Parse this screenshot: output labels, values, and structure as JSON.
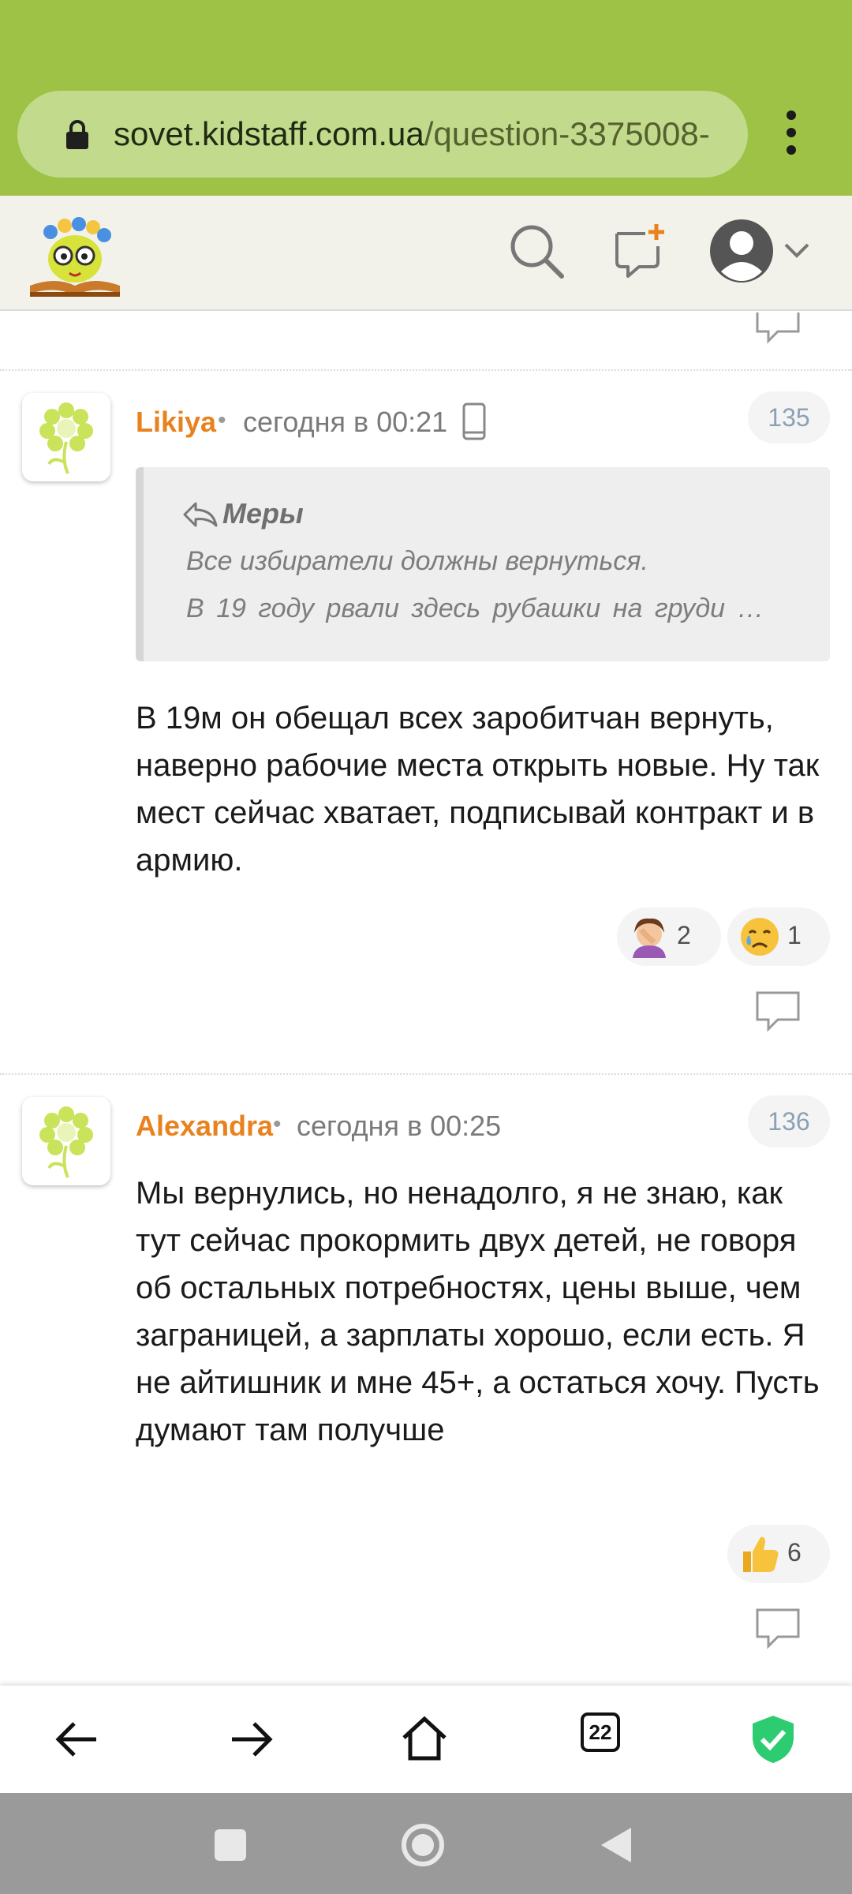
{
  "browser": {
    "url_domain": "sovet.kidstaff.com.ua",
    "url_path": "/question-3375008-",
    "tab_count": "22"
  },
  "site_header": {
    "logo": "kidstaff-logo",
    "icons": [
      "search-icon",
      "new-message-icon",
      "user-avatar-icon",
      "chevron-down-icon"
    ]
  },
  "comments": [
    {
      "author": "Likiya",
      "separator": "•",
      "time": "сегодня в 00:21",
      "device_icon": "mobile-phone-icon",
      "number": "135",
      "quote": {
        "author": "Меры",
        "lines": [
          "Все избиратели должны вернуться.",
          "В 19 году рвали здесь рубашки на груди …"
        ]
      },
      "text": "В 19м он обещал всех заробитчан вернуть, наверно рабочие места открыть новые. Ну так мест сейчас хватает, подписывай контракт и в армию.",
      "reactions": [
        {
          "icon": "facepalm-emoji",
          "count": "2"
        },
        {
          "icon": "crying-face-emoji",
          "count": "1"
        }
      ]
    },
    {
      "author": "Alexandra",
      "separator": "•",
      "time": "сегодня в 00:25",
      "number": "136",
      "text": "Мы вернулись, но ненадолго, я не знаю, как тут сейчас прокормить двух детей, не говоря об остальных потребностях, цены выше, чем заграницей, а зарплаты хорошо, если есть. Я не айтишник и мне 45+, а остаться хочу. Пусть думают там получше",
      "reactions": [
        {
          "icon": "thumbs-up-emoji",
          "count": "6"
        }
      ]
    }
  ],
  "colors": {
    "browser_bar": "#9dc246",
    "author": "#e8821e",
    "shield": "#2ecc71"
  }
}
